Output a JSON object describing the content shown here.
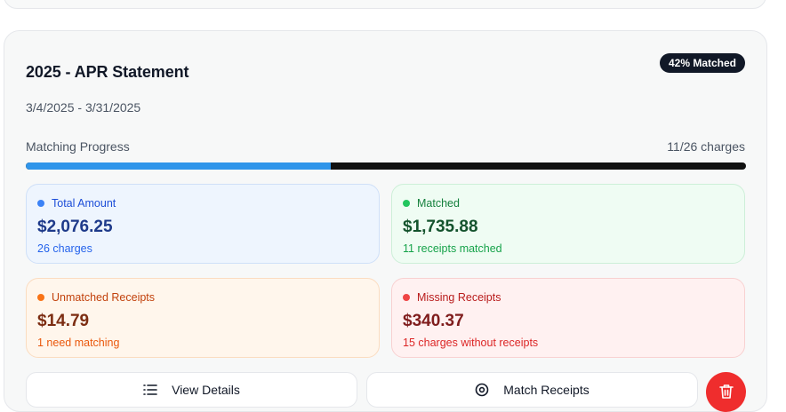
{
  "statement": {
    "title": "2025 - APR Statement",
    "match_badge": "42% Matched",
    "date_range": "3/4/2025 - 3/31/2025"
  },
  "progress": {
    "label": "Matching Progress",
    "count_text": "11/26 charges",
    "fraction": 0.4231,
    "fill_color": "#2f95ea",
    "track_color": "#111111"
  },
  "stats": {
    "total": {
      "label": "Total Amount",
      "amount": "$2,076.25",
      "sub": "26 charges",
      "color": "#3b82f6"
    },
    "matched": {
      "label": "Matched",
      "amount": "$1,735.88",
      "sub": "11 receipts matched",
      "color": "#22c55e"
    },
    "unmatched": {
      "label": "Unmatched Receipts",
      "amount": "$14.79",
      "sub": "1 need matching",
      "color": "#f97316"
    },
    "missing": {
      "label": "Missing Receipts",
      "amount": "$340.37",
      "sub": "15 charges without receipts",
      "color": "#ef4444"
    }
  },
  "actions": {
    "view_details": {
      "label": "View Details",
      "icon": "list-icon"
    },
    "match_receipts": {
      "label": "Match Receipts",
      "icon": "eye-icon"
    },
    "delete": {
      "icon": "trash-icon",
      "color": "#ef2d2d"
    }
  }
}
